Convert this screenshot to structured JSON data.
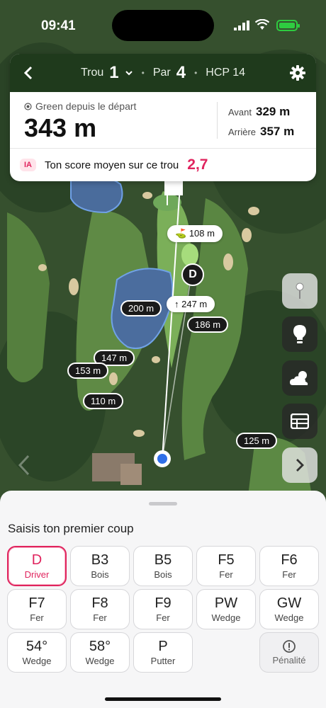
{
  "status": {
    "time": "09:41"
  },
  "header": {
    "hole_label": "Trou",
    "hole_number": "1",
    "par_label": "Par",
    "par_value": "4",
    "hcp": "HCP 14"
  },
  "distance": {
    "label": "Green depuis le départ",
    "value": "343 m",
    "front_label": "Avant",
    "front_value": "329 m",
    "back_label": "Arrière",
    "back_value": "357 m"
  },
  "ai": {
    "badge": "IA",
    "text": "Ton score moyen sur ce trou",
    "value": "2,7"
  },
  "map": {
    "pills": {
      "d108": "108 m",
      "d247": "247 m",
      "d200": "200 m",
      "d186": "186 m",
      "d147": "147 m",
      "d153": "153 m",
      "d110": "110 m",
      "d125": "125 m"
    },
    "tee_label": "D"
  },
  "sheet": {
    "title": "Saisis ton premier coup",
    "clubs": [
      {
        "code": "D",
        "name": "Driver",
        "selected": true
      },
      {
        "code": "B3",
        "name": "Bois"
      },
      {
        "code": "B5",
        "name": "Bois"
      },
      {
        "code": "F5",
        "name": "Fer"
      },
      {
        "code": "F6",
        "name": "Fer"
      },
      {
        "code": "F7",
        "name": "Fer"
      },
      {
        "code": "F8",
        "name": "Fer"
      },
      {
        "code": "F9",
        "name": "Fer"
      },
      {
        "code": "PW",
        "name": "Wedge"
      },
      {
        "code": "GW",
        "name": "Wedge"
      },
      {
        "code": "54°",
        "name": "Wedge"
      },
      {
        "code": "58°",
        "name": "Wedge"
      },
      {
        "code": "P",
        "name": "Putter"
      }
    ],
    "penalty_label": "Pénalité"
  },
  "colors": {
    "accent": "#e0245e",
    "header_bg": "#1f3a1c",
    "locator": "#2f6fe8"
  }
}
